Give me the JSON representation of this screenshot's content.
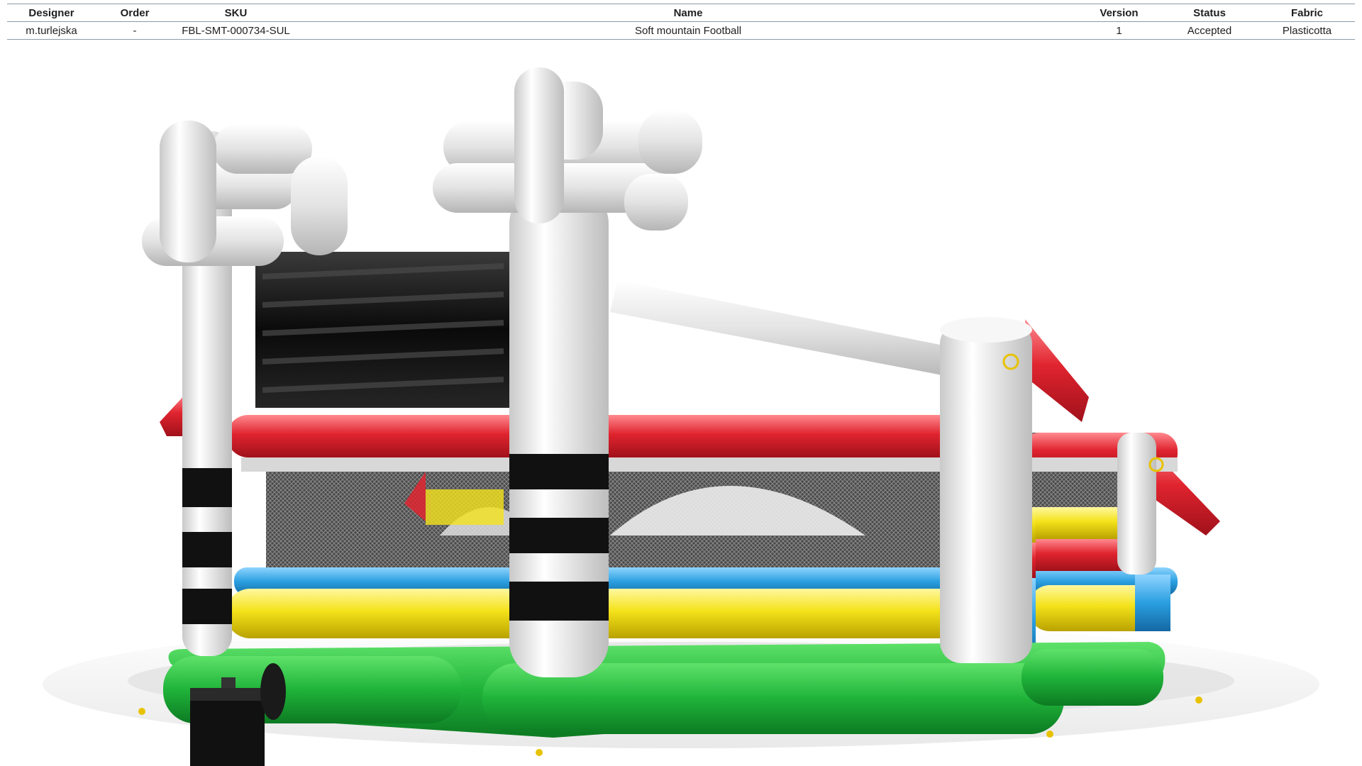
{
  "table": {
    "headers": {
      "designer": "Designer",
      "order": "Order",
      "sku": "SKU",
      "name": "Name",
      "version": "Version",
      "status": "Status",
      "fabric": "Fabric"
    },
    "row": {
      "designer": "m.turlejska",
      "order": "-",
      "sku": "FBL-SMT-000734-SUL",
      "name": "Soft mountain Football",
      "version": "1",
      "status": "Accepted",
      "fabric": "Plasticotta"
    }
  },
  "colors": {
    "green": "#1fb33a",
    "yellow": "#f4e21a",
    "blue": "#2a9fe0",
    "red": "#e0242f",
    "white": "#f3f3f1",
    "black": "#111111",
    "grey": "#dedede"
  },
  "icons": {
    "render": "inflatable-football-arena-render"
  }
}
